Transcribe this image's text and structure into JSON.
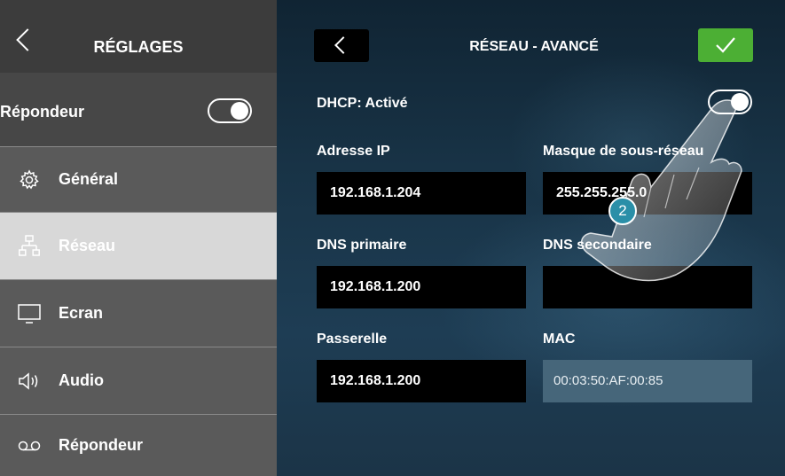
{
  "sidebar": {
    "title": "RÉGLAGES",
    "answer_toggle_label": "Répondeur",
    "answer_toggle_on": true,
    "items": [
      {
        "label": "Général",
        "icon": "gear-icon"
      },
      {
        "label": "Réseau",
        "icon": "network-icon",
        "selected": true
      },
      {
        "label": "Ecran",
        "icon": "monitor-icon"
      },
      {
        "label": "Audio",
        "icon": "speaker-icon"
      },
      {
        "label": "Répondeur",
        "icon": "voicemail-icon"
      }
    ]
  },
  "main": {
    "title": "RÉSEAU - AVANCÉ",
    "dhcp_label": "DHCP: Activé",
    "dhcp_on": true,
    "fields": {
      "ip": {
        "label": "Adresse IP",
        "value": "192.168.1.204"
      },
      "mask": {
        "label": "Masque de sous-réseau",
        "value": "255.255.255.0"
      },
      "dns1": {
        "label": "DNS primaire",
        "value": "192.168.1.200"
      },
      "dns2": {
        "label": "DNS secondaire",
        "value": ""
      },
      "gateway": {
        "label": "Passerelle",
        "value": "192.168.1.200"
      },
      "mac": {
        "label": "MAC",
        "value": "00:03:50:AF:00:85"
      }
    },
    "step_marker": "2"
  },
  "colors": {
    "sidebar_header": "#3c3c3c",
    "sidebar_bg": "#5a5a5a",
    "selected_row": "#d8d8d8",
    "confirm_green": "#4caf34",
    "field_bg": "#000000",
    "readonly_field_bg": "#46667a",
    "step_badge": "#2a8fa8"
  }
}
